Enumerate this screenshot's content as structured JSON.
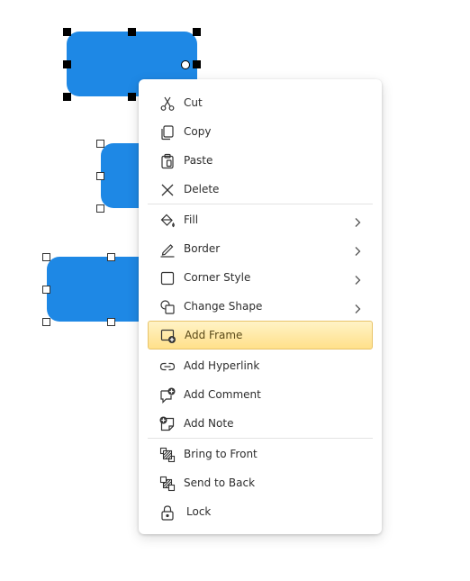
{
  "canvas": {
    "shape_color": "#1e88e5",
    "shapes": [
      {
        "name": "shape-1",
        "selected": true,
        "handle_style": "solid"
      },
      {
        "name": "shape-2",
        "selected": true,
        "handle_style": "hollow"
      },
      {
        "name": "shape-3",
        "selected": true,
        "handle_style": "hollow"
      }
    ]
  },
  "context_menu": {
    "items": [
      {
        "label": "Cut",
        "icon": "scissors-icon"
      },
      {
        "label": "Copy",
        "icon": "copy-icon"
      },
      {
        "label": "Paste",
        "icon": "clipboard-icon"
      },
      {
        "label": "Delete",
        "icon": "close-x-icon"
      },
      {
        "label": "Fill",
        "icon": "paint-bucket-icon",
        "submenu": true
      },
      {
        "label": "Border",
        "icon": "pen-icon",
        "submenu": true
      },
      {
        "label": "Corner Style",
        "icon": "square-corner-icon",
        "submenu": true
      },
      {
        "label": "Change Shape",
        "icon": "change-shape-icon",
        "submenu": true
      },
      {
        "label": "Add Frame",
        "icon": "add-frame-icon",
        "highlighted": true
      },
      {
        "label": "Add Hyperlink",
        "icon": "link-icon"
      },
      {
        "label": "Add Comment",
        "icon": "add-comment-icon"
      },
      {
        "label": "Add Note",
        "icon": "add-note-icon"
      },
      {
        "label": "Bring to Front",
        "icon": "bring-to-front-icon"
      },
      {
        "label": "Send to Back",
        "icon": "send-to-back-icon"
      },
      {
        "label": "Lock",
        "icon": "lock-icon"
      }
    ],
    "highlight_color": "#ffe08a"
  }
}
